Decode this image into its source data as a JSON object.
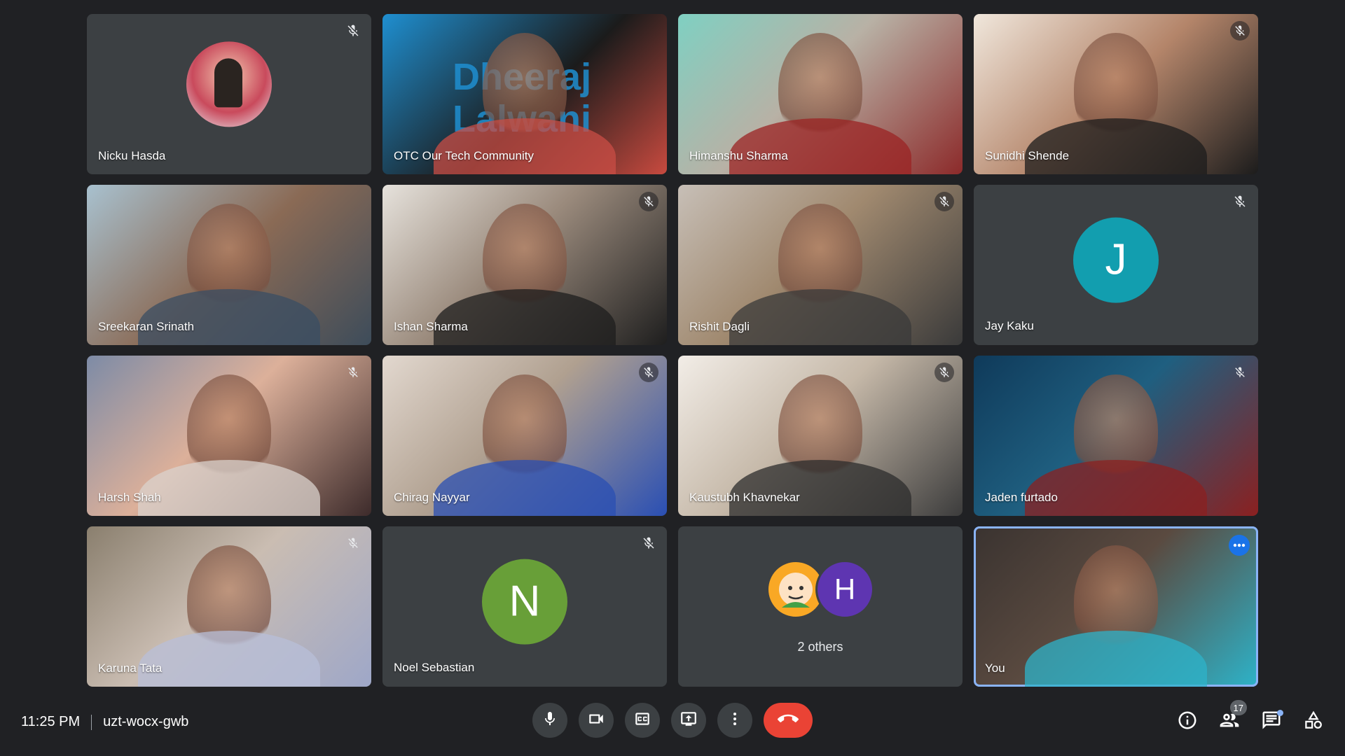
{
  "participants": [
    {
      "name": "Nicku Hasda",
      "muted": true,
      "type": "photo-avatar"
    },
    {
      "name": "OTC Our Tech Community",
      "muted": false,
      "type": "video"
    },
    {
      "name": "Himanshu Sharma",
      "muted": false,
      "type": "video"
    },
    {
      "name": "Sunidhi Shende",
      "muted": true,
      "type": "video"
    },
    {
      "name": "Sreekaran Srinath",
      "muted": false,
      "type": "video"
    },
    {
      "name": "Ishan Sharma",
      "muted": true,
      "type": "video"
    },
    {
      "name": "Rishit Dagli",
      "muted": true,
      "type": "video"
    },
    {
      "name": "Jay Kaku",
      "muted": true,
      "type": "letter",
      "initial": "J",
      "color": "#129eaf"
    },
    {
      "name": "Harsh Shah",
      "muted": true,
      "type": "video"
    },
    {
      "name": "Chirag Nayyar",
      "muted": true,
      "type": "video"
    },
    {
      "name": "Kaustubh Khavnekar",
      "muted": true,
      "type": "video"
    },
    {
      "name": "Jaden furtado",
      "muted": true,
      "type": "video"
    },
    {
      "name": "Karuna Tata",
      "muted": true,
      "type": "video"
    },
    {
      "name": "Noel Sebastian",
      "muted": true,
      "type": "letter",
      "initial": "N",
      "color": "#689f38"
    },
    {
      "name": "",
      "type": "others",
      "label": "2 others",
      "avatars": [
        {
          "kind": "emoji-face",
          "color": "#f9a825"
        },
        {
          "initial": "H",
          "color": "#5e35b1"
        }
      ]
    },
    {
      "name": "You",
      "muted": false,
      "type": "video-self"
    }
  ],
  "video_text": {
    "banner": "Dheeraj Lalwani"
  },
  "bottom_bar": {
    "time": "11:25 PM",
    "meeting_code": "uzt-wocx-gwb",
    "people_count": "17"
  },
  "icons": {
    "mic": "mic-icon",
    "camera": "camera-icon",
    "captions": "captions-icon",
    "present": "present-icon",
    "more": "more-vert-icon",
    "end": "end-call-icon",
    "info": "info-icon",
    "people": "people-icon",
    "chat": "chat-icon",
    "activities": "activities-icon",
    "muted": "mic-off-icon"
  },
  "colors": {
    "background": "#202124",
    "tile": "#3c4043",
    "end_call": "#ea4335",
    "accent": "#8ab4f8"
  }
}
